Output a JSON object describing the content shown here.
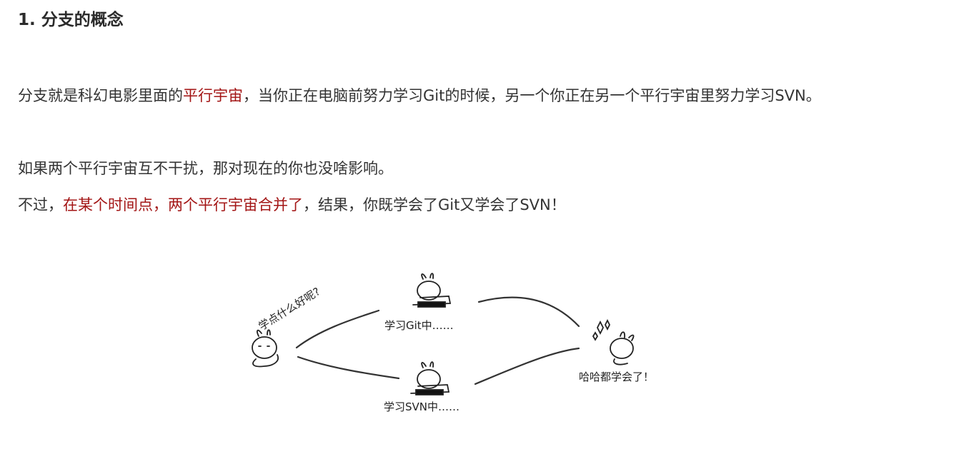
{
  "heading": "1. 分支的概念",
  "para1": {
    "part1": "分支就是科幻电影里面的",
    "highlight": "平行宇宙",
    "part2": "，当你正在电脑前努力学习Git的时候，另一个你正在另一个平行宇宙里努力学习SVN。"
  },
  "para2": "如果两个平行宇宙互不干扰，那对现在的你也没啥影响。",
  "para3": {
    "part1": "不过，",
    "highlight": "在某个时间点，两个平行宇宙合并了",
    "part2": "，结果，你既学会了Git又学会了SVN！"
  },
  "illustration": {
    "question": "学点什么好呢?",
    "git_label": "学习Git中……",
    "svn_label": "学习SVN中……",
    "done_label": "哈哈都学会了！"
  },
  "colors": {
    "highlight": "#a31515",
    "text": "#333333"
  }
}
